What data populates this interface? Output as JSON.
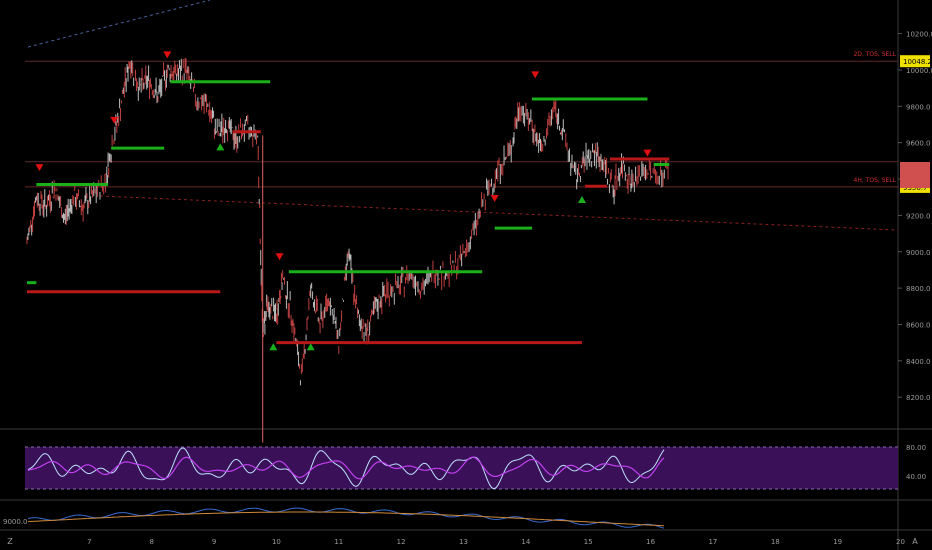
{
  "chart_data": {
    "type": "candlestick",
    "instrument_unit": "price",
    "ylim": [
      8000,
      10300
    ],
    "y_ticks": [
      "10200.0",
      "10000.0",
      "9800.0",
      "9600.0",
      "9400.0",
      "9200.0",
      "9000.0",
      "8800.0",
      "8600.0",
      "8400.0",
      "8200.0"
    ],
    "x_ticks": [
      "7",
      "8",
      "9",
      "10",
      "11",
      "12",
      "13",
      "14",
      "15",
      "16",
      "17",
      "18",
      "19",
      "20"
    ],
    "close_series": [
      {
        "x": 6.0,
        "y": 9050
      },
      {
        "x": 6.15,
        "y": 9300
      },
      {
        "x": 6.3,
        "y": 9250
      },
      {
        "x": 6.45,
        "y": 9350
      },
      {
        "x": 6.6,
        "y": 9180
      },
      {
        "x": 6.75,
        "y": 9300
      },
      {
        "x": 6.9,
        "y": 9250
      },
      {
        "x": 7.05,
        "y": 9300
      },
      {
        "x": 7.25,
        "y": 9380
      },
      {
        "x": 7.35,
        "y": 9560
      },
      {
        "x": 7.5,
        "y": 9800
      },
      {
        "x": 7.65,
        "y": 10050
      },
      {
        "x": 7.8,
        "y": 9900
      },
      {
        "x": 7.95,
        "y": 9950
      },
      {
        "x": 8.1,
        "y": 9850
      },
      {
        "x": 8.25,
        "y": 10000
      },
      {
        "x": 8.4,
        "y": 9980
      },
      {
        "x": 8.55,
        "y": 10000
      },
      {
        "x": 8.7,
        "y": 9850
      },
      {
        "x": 8.9,
        "y": 9800
      },
      {
        "x": 9.05,
        "y": 9650
      },
      {
        "x": 9.2,
        "y": 9700
      },
      {
        "x": 9.35,
        "y": 9620
      },
      {
        "x": 9.5,
        "y": 9680
      },
      {
        "x": 9.7,
        "y": 9640
      },
      {
        "x": 9.78,
        "y": 8550
      },
      {
        "x": 9.85,
        "y": 8700
      },
      {
        "x": 10.0,
        "y": 8650
      },
      {
        "x": 10.1,
        "y": 8850
      },
      {
        "x": 10.25,
        "y": 8650
      },
      {
        "x": 10.4,
        "y": 8300
      },
      {
        "x": 10.55,
        "y": 8800
      },
      {
        "x": 10.7,
        "y": 8600
      },
      {
        "x": 10.85,
        "y": 8750
      },
      {
        "x": 11.0,
        "y": 8500
      },
      {
        "x": 11.15,
        "y": 9000
      },
      {
        "x": 11.3,
        "y": 8650
      },
      {
        "x": 11.45,
        "y": 8550
      },
      {
        "x": 11.6,
        "y": 8700
      },
      {
        "x": 11.75,
        "y": 8780
      },
      {
        "x": 11.95,
        "y": 8800
      },
      {
        "x": 12.15,
        "y": 8880
      },
      {
        "x": 12.35,
        "y": 8800
      },
      {
        "x": 12.55,
        "y": 8900
      },
      {
        "x": 12.75,
        "y": 8880
      },
      {
        "x": 12.95,
        "y": 8950
      },
      {
        "x": 13.15,
        "y": 9100
      },
      {
        "x": 13.35,
        "y": 9300
      },
      {
        "x": 13.55,
        "y": 9450
      },
      {
        "x": 13.75,
        "y": 9550
      },
      {
        "x": 13.9,
        "y": 9800
      },
      {
        "x": 14.1,
        "y": 9700
      },
      {
        "x": 14.25,
        "y": 9550
      },
      {
        "x": 14.45,
        "y": 9800
      },
      {
        "x": 14.6,
        "y": 9650
      },
      {
        "x": 14.8,
        "y": 9400
      },
      {
        "x": 14.95,
        "y": 9500
      },
      {
        "x": 15.1,
        "y": 9550
      },
      {
        "x": 15.25,
        "y": 9480
      },
      {
        "x": 15.4,
        "y": 9350
      },
      {
        "x": 15.55,
        "y": 9480
      },
      {
        "x": 15.7,
        "y": 9380
      },
      {
        "x": 15.9,
        "y": 9450
      },
      {
        "x": 16.1,
        "y": 9420
      },
      {
        "x": 16.3,
        "y": 9460
      }
    ],
    "support_resistance": [
      {
        "role": "support",
        "y": 9370,
        "x": [
          6.15,
          7.3
        ]
      },
      {
        "role": "support",
        "y": 9570,
        "x": [
          7.35,
          8.2
        ]
      },
      {
        "role": "support",
        "y": 9935,
        "x": [
          8.3,
          9.9
        ]
      },
      {
        "role": "resistance",
        "y": 9660,
        "x": [
          9.3,
          9.75
        ]
      },
      {
        "role": "support",
        "y": 8890,
        "x": [
          10.2,
          13.3
        ]
      },
      {
        "role": "resistance",
        "y": 8500,
        "x": [
          10.0,
          14.9
        ]
      },
      {
        "role": "resistance",
        "y": 8780,
        "x": [
          6.0,
          9.1
        ]
      },
      {
        "role": "support",
        "y": 8830,
        "x": [
          6.0,
          6.15
        ]
      },
      {
        "role": "support",
        "y": 9130,
        "x": [
          13.5,
          14.1
        ]
      },
      {
        "role": "support",
        "y": 9840,
        "x": [
          14.1,
          15.95
        ]
      },
      {
        "role": "resistance",
        "y": 9360,
        "x": [
          14.95,
          15.3
        ]
      },
      {
        "role": "resistance",
        "y": 9510,
        "x": [
          15.35,
          16.3
        ]
      },
      {
        "role": "support",
        "y": 9480,
        "x": [
          16.05,
          16.3
        ]
      }
    ],
    "sell_signals": [
      {
        "x": 6.2,
        "y": 9460
      },
      {
        "x": 7.4,
        "y": 9720
      },
      {
        "x": 8.25,
        "y": 10080
      },
      {
        "x": 10.05,
        "y": 8970
      },
      {
        "x": 13.5,
        "y": 9290
      },
      {
        "x": 14.15,
        "y": 9970
      },
      {
        "x": 15.95,
        "y": 9540
      }
    ],
    "buy_signals": [
      {
        "x": 9.1,
        "y": 9580
      },
      {
        "x": 9.95,
        "y": 8480
      },
      {
        "x": 10.55,
        "y": 8480
      },
      {
        "x": 14.9,
        "y": 9290
      }
    ],
    "horizontal_levels": [
      {
        "label": "2D, TOS, SELL",
        "y": 10048.2,
        "price_tag": "10048.2"
      },
      {
        "label": "4H, TOS, SELL",
        "y": 9356.7,
        "price_tag": "9356.7"
      },
      {
        "y": 9495,
        "price_tag": ""
      }
    ],
    "oscillator": {
      "levels": [
        "80.00",
        "40.00"
      ]
    },
    "lower_pane": {
      "levels": [
        "9000.0"
      ]
    }
  },
  "axis": {
    "corner_left": "Z",
    "corner_right": "A"
  }
}
